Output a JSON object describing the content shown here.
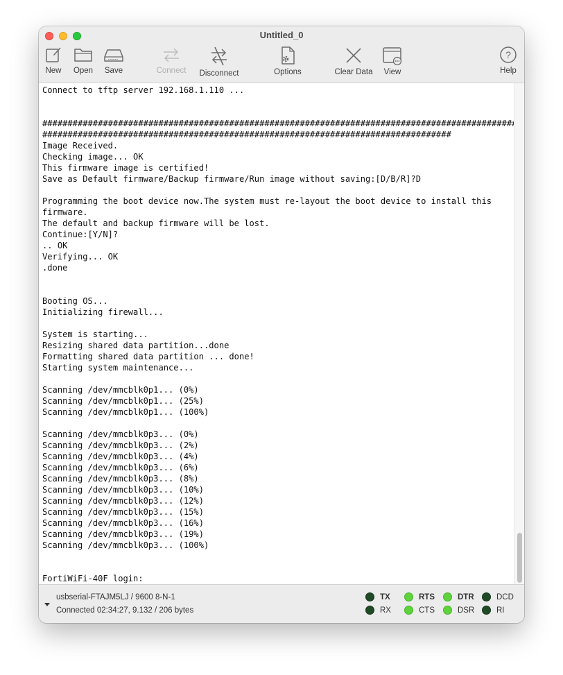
{
  "window": {
    "title": "Untitled_0"
  },
  "toolbar": {
    "new": "New",
    "open": "Open",
    "save": "Save",
    "connect": "Connect",
    "disconnect": "Disconnect",
    "options": "Options",
    "clear_data": "Clear Data",
    "view": "View",
    "help": "Help"
  },
  "terminal": {
    "lines": [
      "Connect to tftp server 192.168.1.110 ...",
      "",
      "",
      "##################################################################################################",
      "#################################################################################",
      "Image Received.",
      "Checking image... OK",
      "This firmware image is certified!",
      "Save as Default firmware/Backup firmware/Run image without saving:[D/B/R]?D",
      "",
      "Programming the boot device now.The system must re-layout the boot device to install this",
      "firmware.",
      "The default and backup firmware will be lost.",
      "Continue:[Y/N]?",
      ".. OK",
      "Verifying... OK",
      ".done",
      "",
      "",
      "Booting OS...",
      "Initializing firewall...",
      "",
      "System is starting...",
      "Resizing shared data partition...done",
      "Formatting shared data partition ... done!",
      "Starting system maintenance...",
      "",
      "Scanning /dev/mmcblk0p1... (0%)",
      "Scanning /dev/mmcblk0p1... (25%)",
      "Scanning /dev/mmcblk0p1... (100%)",
      "",
      "Scanning /dev/mmcblk0p3... (0%)",
      "Scanning /dev/mmcblk0p3... (2%)",
      "Scanning /dev/mmcblk0p3... (4%)",
      "Scanning /dev/mmcblk0p3... (6%)",
      "Scanning /dev/mmcblk0p3... (8%)",
      "Scanning /dev/mmcblk0p3... (10%)",
      "Scanning /dev/mmcblk0p3... (12%)",
      "Scanning /dev/mmcblk0p3... (15%)",
      "Scanning /dev/mmcblk0p3... (16%)",
      "Scanning /dev/mmcblk0p3... (19%)",
      "Scanning /dev/mmcblk0p3... (100%)",
      "",
      "",
      "FortiWiFi-40F login:"
    ]
  },
  "status": {
    "port": "usbserial-FTAJM5LJ / 9600 8-N-1",
    "connection": "Connected 02:34:27, 9.132 / 206 bytes",
    "indicators": {
      "tx": {
        "label": "TX",
        "on": false
      },
      "rx": {
        "label": "RX",
        "on": false
      },
      "rts": {
        "label": "RTS",
        "on": true
      },
      "cts": {
        "label": "CTS",
        "on": true
      },
      "dtr": {
        "label": "DTR",
        "on": true
      },
      "dsr": {
        "label": "DSR",
        "on": true
      },
      "dcd": {
        "label": "DCD",
        "on": false
      },
      "ri": {
        "label": "RI",
        "on": false
      }
    }
  }
}
